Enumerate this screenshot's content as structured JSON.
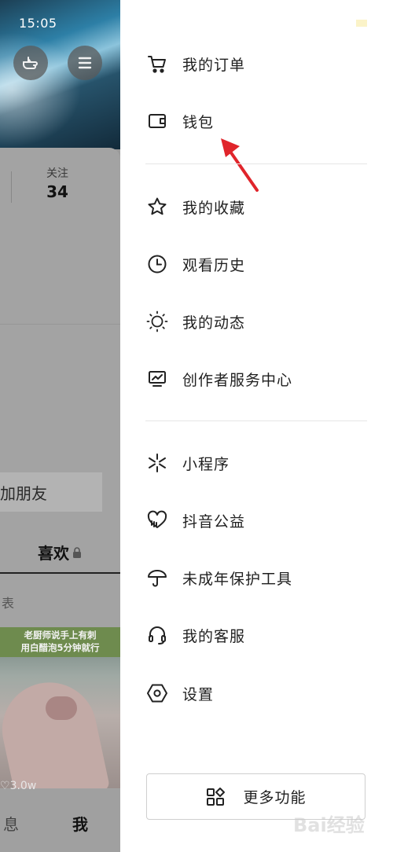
{
  "status_bar": {
    "time": "15:05"
  },
  "background": {
    "follow_label": "关注",
    "follow_count": "34",
    "add_friend_label": "加朋友",
    "likes_tab_label": "喜欢",
    "partial_tab_label": "表",
    "thumbnail_text_line1": "老厨师说手上有刺",
    "thumbnail_text_line2": "用白醋泡5分钟就行",
    "thumbnail_likes": "3.0w",
    "nav_messages_label": "息",
    "nav_me_label": "我"
  },
  "drawer": {
    "group1": [
      {
        "label": "我的订单",
        "icon": "cart-icon"
      },
      {
        "label": "钱包",
        "icon": "wallet-icon"
      }
    ],
    "group2": [
      {
        "label": "我的收藏",
        "icon": "star-icon"
      },
      {
        "label": "观看历史",
        "icon": "clock-icon"
      },
      {
        "label": "我的动态",
        "icon": "sun-icon"
      },
      {
        "label": "创作者服务中心",
        "icon": "creator-monitor-icon"
      }
    ],
    "group3": [
      {
        "label": "小程序",
        "icon": "mini-program-icon"
      },
      {
        "label": "抖音公益",
        "icon": "charity-heart-icon"
      },
      {
        "label": "未成年保护工具",
        "icon": "umbrella-icon"
      },
      {
        "label": "我的客服",
        "icon": "headset-icon"
      },
      {
        "label": "设置",
        "icon": "settings-hexagon-icon"
      }
    ],
    "more_button_label": "更多功能"
  },
  "watermark": "Bai经验",
  "colors": {
    "annotation_arrow": "#e0252b",
    "text": "#1f1f1f",
    "divider": "#e6e6e6"
  }
}
